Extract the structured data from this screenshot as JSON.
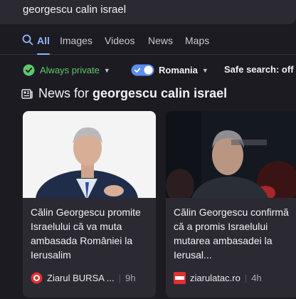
{
  "search": {
    "query": "georgescu calin israel"
  },
  "tabs": [
    {
      "label": "All"
    },
    {
      "label": "Images"
    },
    {
      "label": "Videos"
    },
    {
      "label": "News"
    },
    {
      "label": "Maps"
    }
  ],
  "filters": {
    "private": "Always private",
    "country": "Romania",
    "safe_search": "Safe search: off"
  },
  "news": {
    "prefix": "News for",
    "query": "georgescu calin israel",
    "cards": [
      {
        "title": "Călin Georgescu promite Israelului că va muta ambasada României la Ierusalim",
        "source": "Ziarul BURSA ...",
        "age": "9h"
      },
      {
        "title": "Călin Georgescu confirmă că a promis Israelului mutarea ambasadei la Ierusal...",
        "source": "ziarulatac.ro",
        "age": "4h"
      }
    ]
  },
  "colors": {
    "background": "#1c1b22",
    "accent": "#8fb7ff",
    "private_green": "#5dc86b",
    "toggle_blue": "#5b8ef0"
  }
}
